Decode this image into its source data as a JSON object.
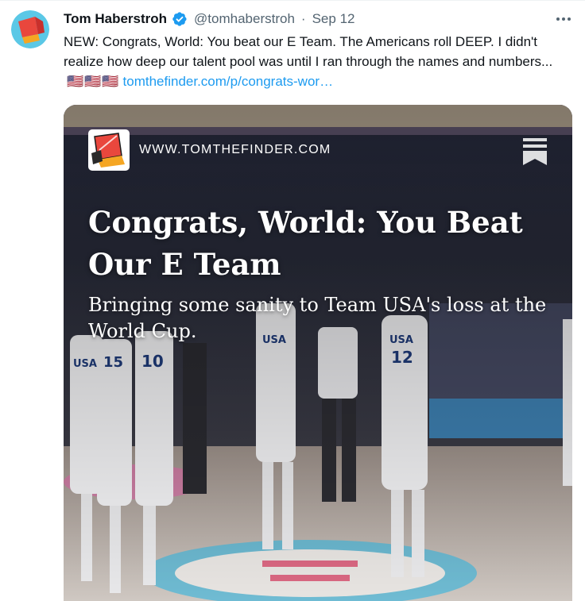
{
  "tweet": {
    "author_name": "Tom Haberstroh",
    "handle": "@tomhaberstroh",
    "separator": "·",
    "date": "Sep 12",
    "text": "NEW:  Congrats, World: You beat our E Team. The Americans roll DEEP. I didn't realize how deep our talent pool was until I ran through the names and numbers...",
    "flags": "🇺🇸🇺🇸🇺🇸",
    "link_text": "tomthefinder.com/p/congrats-wor…"
  },
  "card": {
    "domain": "WWW.TOMTHEFINDER.COM",
    "title": "Congrats, World: You Beat Our E Team",
    "subtitle": "Bringing some sanity to Team USA's loss at the World Cup.",
    "jersey_numbers": [
      "USA",
      "USA",
      "15",
      "10",
      "USA",
      "12"
    ]
  },
  "icons": {
    "avatar": "flashlight-logo",
    "verified": "verified-badge-icon",
    "more": "more-options-icon",
    "bookmark": "bookmark-icon"
  },
  "colors": {
    "accent": "#1d9bf0",
    "text_primary": "#0f1419",
    "text_secondary": "#536471"
  }
}
